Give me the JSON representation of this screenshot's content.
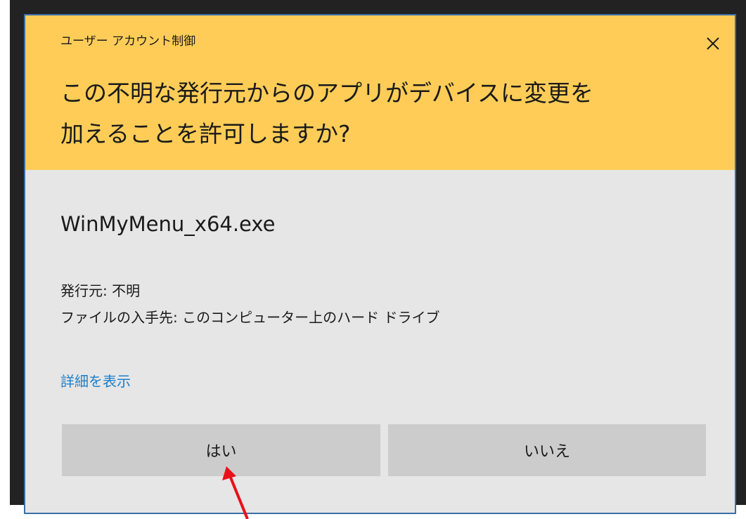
{
  "dialog": {
    "app_title": "ユーザー アカウント制御",
    "question_line1": "この不明な発行元からのアプリがデバイスに変更を",
    "question_line2": "加えることを許可しますか?",
    "program_name": "WinMyMenu_x64.exe",
    "publisher_line": "発行元: 不明",
    "origin_line": "ファイルの入手先: このコンピューター上のハード ドライブ",
    "details_link": "詳細を表示",
    "yes_label": "はい",
    "no_label": "いいえ"
  },
  "icons": {
    "close": "close-icon",
    "annotation": "red-arrow-icon"
  },
  "colors": {
    "header_bg": "#ffcd57",
    "body_bg": "#e6e6e6",
    "button_bg": "#cccccc",
    "link": "#1e7ec8",
    "border": "#3b6fa8",
    "arrow": "#e8101a"
  }
}
